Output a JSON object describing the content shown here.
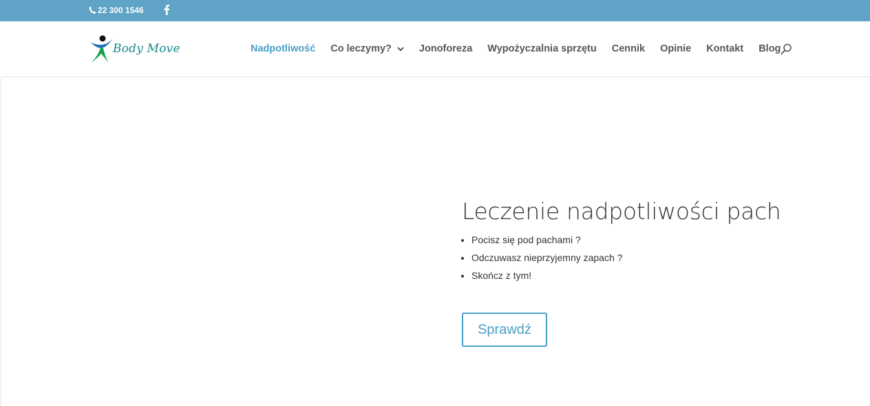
{
  "topbar": {
    "phone": "22 300 1546",
    "phone_icon": "phone-icon",
    "social_icon": "facebook-icon"
  },
  "header": {
    "logo_text": "Body Move",
    "nav": [
      {
        "label": "Nadpotliwość",
        "active": true
      },
      {
        "label": "Co leczymy?",
        "has_dropdown": true
      },
      {
        "label": "Jonoforeza"
      },
      {
        "label": "Wypożyczalnia sprzętu"
      },
      {
        "label": "Cennik"
      },
      {
        "label": "Opinie"
      },
      {
        "label": "Kontakt"
      },
      {
        "label": "Blog"
      }
    ],
    "search_icon": "search-icon"
  },
  "hero": {
    "title": "Leczenie nadpotliwości pach",
    "bullets": [
      "Pocisz się pod pachami ?",
      "Odczuwasz nieprzyjemny zapach ?",
      "Skończ z tym!"
    ],
    "cta_label": "Sprawdź"
  },
  "colors": {
    "topbar_bg": "#5fa3c6",
    "accent": "#4a9fc6",
    "logo_text": "#1a8a8f",
    "nav_text": "#555555"
  }
}
